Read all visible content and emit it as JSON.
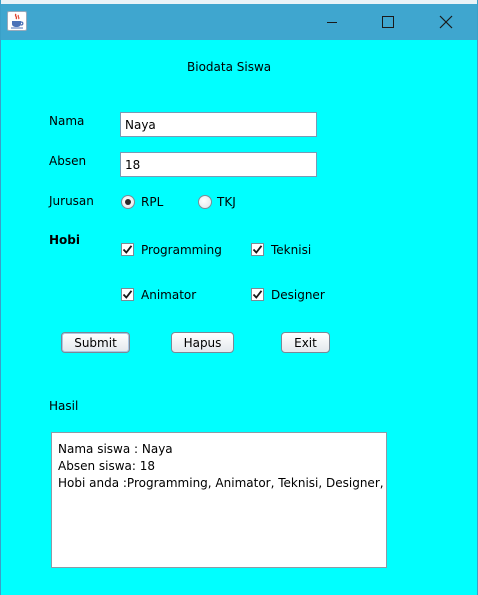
{
  "window": {
    "title": "",
    "app_icon": "java-cup-icon",
    "controls": {
      "minimize": "minimize-icon",
      "maximize": "maximize-icon",
      "close": "close-icon"
    }
  },
  "form": {
    "heading": "Biodata Siswa",
    "nama_label": "Nama",
    "nama_value": "Naya",
    "absen_label": "Absen",
    "absen_value": "18",
    "jurusan_label": "Jurusan",
    "jurusan_options": [
      {
        "label": "RPL",
        "selected": true
      },
      {
        "label": "TKJ",
        "selected": false
      }
    ],
    "hobi_label": "Hobi",
    "hobi_options": [
      {
        "label": "Programming",
        "checked": true
      },
      {
        "label": "Teknisi",
        "checked": true
      },
      {
        "label": "Animator",
        "checked": true
      },
      {
        "label": "Designer",
        "checked": true
      }
    ]
  },
  "buttons": {
    "submit": "Submit",
    "hapus": "Hapus",
    "exit": "Exit"
  },
  "hasil": {
    "label": "Hasil",
    "lines": [
      "Nama siswa : Naya",
      "Absen siswa: 18",
      "Hobi anda :Programming, Animator, Teknisi, Designer,"
    ]
  },
  "colors": {
    "background": "#00ffff",
    "titlebar": "#3fa6cf"
  }
}
